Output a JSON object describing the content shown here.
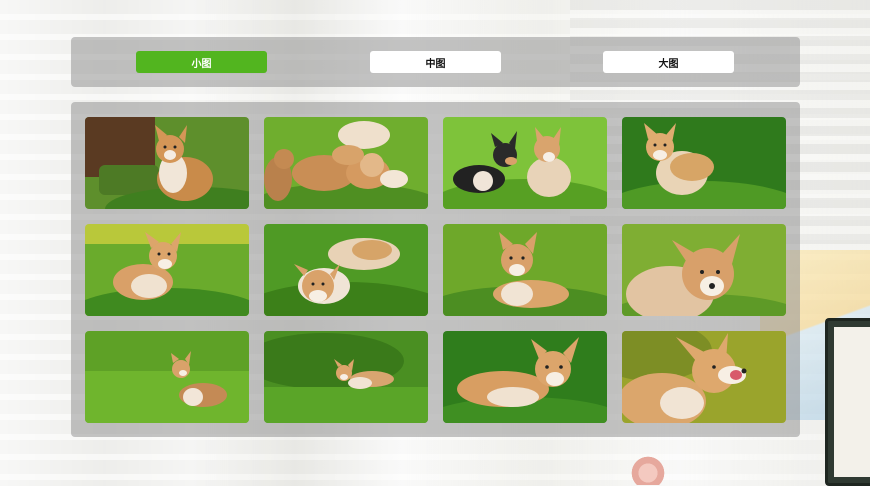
{
  "toolbar": {
    "tabs": [
      {
        "label": "小图",
        "active": true
      },
      {
        "label": "中图",
        "active": false
      },
      {
        "label": "大图",
        "active": false
      }
    ],
    "active_color": "#52b51f"
  },
  "gallery": {
    "photos": [
      {
        "name": "photo-corgi-puppy-on-log"
      },
      {
        "name": "photo-corgi-puppies-group-grass"
      },
      {
        "name": "photo-corgi-two-puppies-playing"
      },
      {
        "name": "photo-corgi-puppy-sitting-grass"
      },
      {
        "name": "photo-corgi-puppy-standing-grass"
      },
      {
        "name": "photo-corgi-puppy-lying-grass"
      },
      {
        "name": "photo-corgi-puppy-lying-front"
      },
      {
        "name": "photo-corgi-closeup-face"
      },
      {
        "name": "photo-corgi-puppy-side-green"
      },
      {
        "name": "photo-corgi-puppy-running-grass"
      },
      {
        "name": "photo-corgi-lying-lawn"
      },
      {
        "name": "photo-corgi-licking-nose"
      }
    ]
  }
}
